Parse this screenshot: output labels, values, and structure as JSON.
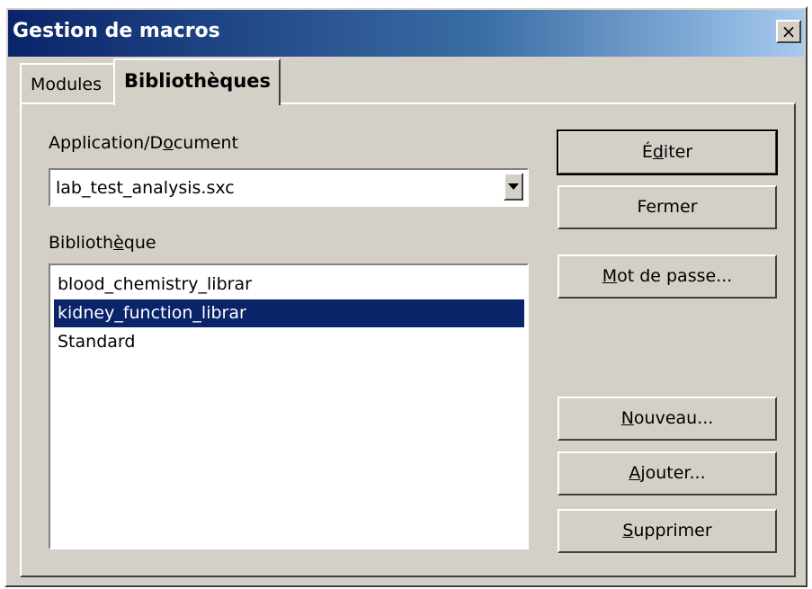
{
  "window": {
    "title": "Gestion de macros",
    "close_label": "×"
  },
  "tabs": [
    {
      "label": "Modules",
      "active": false
    },
    {
      "label": "Bibliothèques",
      "active": true
    }
  ],
  "fields": {
    "app_label_pre": "Application/D",
    "app_label_key": "o",
    "app_label_post": "cument",
    "app_value": "lab_test_analysis.sxc",
    "lib_label_pre": "Biblioth",
    "lib_label_key": "è",
    "lib_label_post": "que"
  },
  "libraries": [
    {
      "name": "blood_chemistry_librar",
      "selected": false
    },
    {
      "name": "kidney_function_librar",
      "selected": true
    },
    {
      "name": "Standard",
      "selected": false
    }
  ],
  "buttons": {
    "edit_pre": "É",
    "edit_key": "d",
    "edit_post": "iter",
    "close_label": "Fermer",
    "password_key": "M",
    "password_post": "ot de passe...",
    "new_key": "N",
    "new_post": "ouveau...",
    "add_key": "A",
    "add_post": "jouter...",
    "delete_key": "S",
    "delete_post": "upprimer"
  },
  "colors": {
    "titlebar_start": "#0a246a",
    "selection": "#0a246a",
    "face": "#d4d0c8"
  }
}
